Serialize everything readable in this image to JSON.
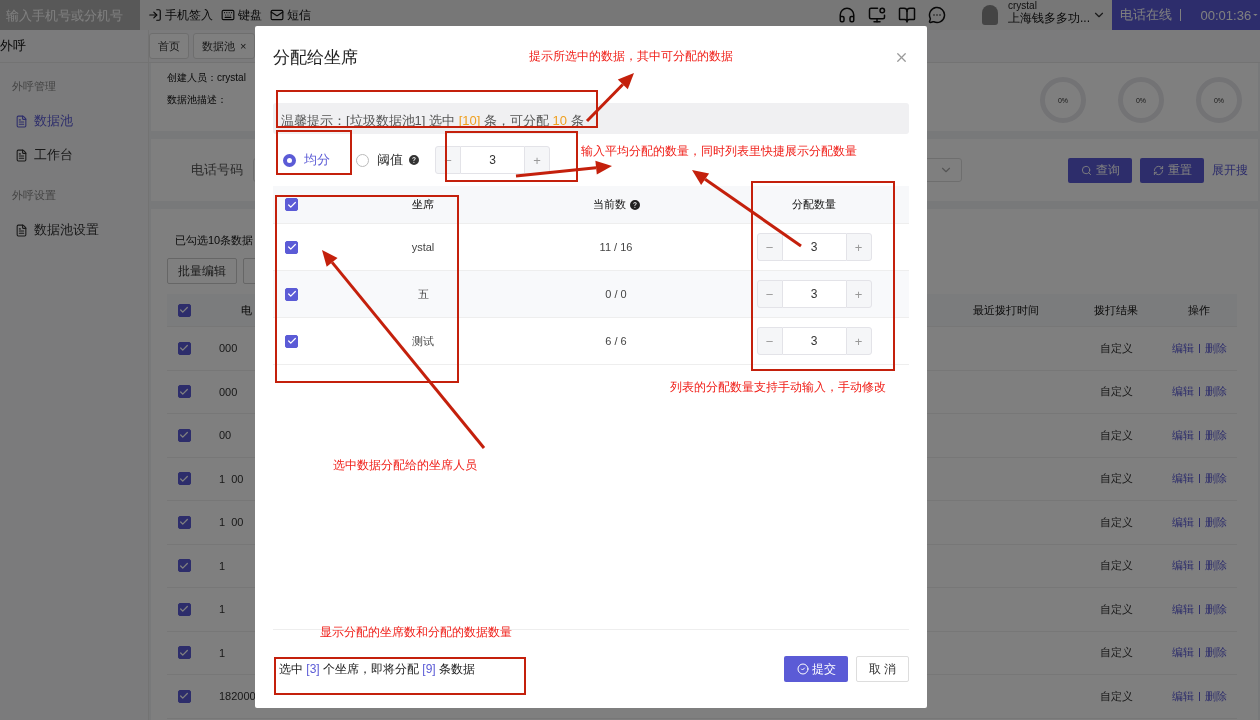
{
  "top_bar": {
    "search_placeholder": "输入手机号或分机号",
    "actions": [
      {
        "label": "手机签入",
        "kind": "signin"
      },
      {
        "label": "键盘",
        "kind": "keyboard"
      },
      {
        "label": "短信",
        "kind": "mail"
      }
    ],
    "user_name": "crystal",
    "company": "上海钱多多功...",
    "status": "电话在线",
    "timer": "00:01:36"
  },
  "sidebar": {
    "title": "外呼",
    "sections": [
      {
        "heading": "外呼管理",
        "items": [
          {
            "label": "数据池",
            "selected": true
          },
          {
            "label": "工作台",
            "selected": false
          }
        ]
      },
      {
        "heading": "外呼设置",
        "items": [
          {
            "label": "数据池设置",
            "selected": false
          }
        ]
      }
    ]
  },
  "page_tabs": [
    {
      "label": "首页"
    },
    {
      "label": "数据池",
      "close_mark": "×"
    }
  ],
  "info": {
    "creator_label": "创建人员：",
    "creator": "crystal",
    "description_label": "数据池描述：",
    "gauges": [
      "0%",
      "0%",
      "0%"
    ]
  },
  "search": {
    "label": "电话号码",
    "buttons": [
      {
        "label": "查询",
        "kind": "search"
      },
      {
        "label": "重置",
        "kind": "reset"
      }
    ],
    "expand_link": "展开搜"
  },
  "list": {
    "selected_count": "已勾选10条数据",
    "buttons": [
      "批量编辑"
    ],
    "header_checked": true,
    "columns": [
      "电",
      "最近拨打时间",
      "拨打结果",
      "操作"
    ],
    "rows": [
      {
        "checked": true,
        "phone": "000",
        "result": "自定义",
        "edit": "编辑",
        "delete": "删除"
      },
      {
        "checked": true,
        "phone": "000",
        "result": "自定义",
        "edit": "编辑",
        "delete": "删除"
      },
      {
        "checked": true,
        "phone": "00",
        "result": "自定义",
        "edit": "编辑",
        "delete": "删除"
      },
      {
        "checked": true,
        "phone": "1  00",
        "result": "自定义",
        "edit": "编辑",
        "delete": "删除"
      },
      {
        "checked": true,
        "phone": "1  00",
        "result": "自定义",
        "edit": "编辑",
        "delete": "删除"
      },
      {
        "checked": true,
        "phone": "1",
        "result": "自定义",
        "edit": "编辑",
        "delete": "删除"
      },
      {
        "checked": true,
        "phone": "1",
        "result": "自定义",
        "edit": "编辑",
        "delete": "删除"
      },
      {
        "checked": true,
        "phone": "1",
        "result": "自定义",
        "edit": "编辑",
        "delete": "删除"
      },
      {
        "checked": true,
        "phone": "182000",
        "result": "自定义",
        "edit": "编辑",
        "delete": "删除"
      }
    ]
  },
  "dialog": {
    "title": "分配给坐席",
    "tip": [
      {
        "text": "温馨提示：[垃圾数据池1] 选中 ",
        "highlight": false
      },
      {
        "text": "[10]",
        "highlight": true
      },
      {
        "text": " 条，可分配 ",
        "highlight": false
      },
      {
        "text": "10",
        "highlight": true
      },
      {
        "text": " 条",
        "highlight": false
      }
    ],
    "modes": [
      {
        "label": "均分",
        "selected": true,
        "help": false
      },
      {
        "label": "阈值",
        "selected": false,
        "help": true
      }
    ],
    "stepper": {
      "minus": "−",
      "value": "3",
      "plus": "+"
    },
    "header_checked": true,
    "columns": [
      {
        "label": "坐席",
        "help": false
      },
      {
        "label": "当前数",
        "help": true
      },
      {
        "label": "分配数量",
        "help": false
      }
    ],
    "rows": [
      {
        "checked": true,
        "agent": "ystal",
        "current": "11 / 16",
        "minus": "−",
        "amount": "3",
        "plus": "+"
      },
      {
        "checked": true,
        "agent": "五",
        "current": "0 / 0",
        "minus": "−",
        "amount": "3",
        "plus": "+"
      },
      {
        "checked": true,
        "agent": "测试",
        "current": "6 / 6",
        "minus": "−",
        "amount": "3",
        "plus": "+"
      }
    ],
    "summary": [
      {
        "text": "选中 ",
        "highlight": false
      },
      {
        "text": "[3]",
        "highlight": true
      },
      {
        "text": " 个坐席，即将分配 ",
        "highlight": false
      },
      {
        "text": "[9]",
        "highlight": true
      },
      {
        "text": " 条数据",
        "highlight": false
      }
    ],
    "submit": "提交",
    "cancel": "取 消"
  },
  "annotations": [
    "提示所选中的数据，其中可分配的数据",
    "输入平均分配的数量，同时列表里快捷展示分配数量",
    "列表的分配数量支持手动输入，手动修改",
    "选中数据分配给的坐席人员",
    "显示分配的坐席数和分配的数据数量"
  ]
}
